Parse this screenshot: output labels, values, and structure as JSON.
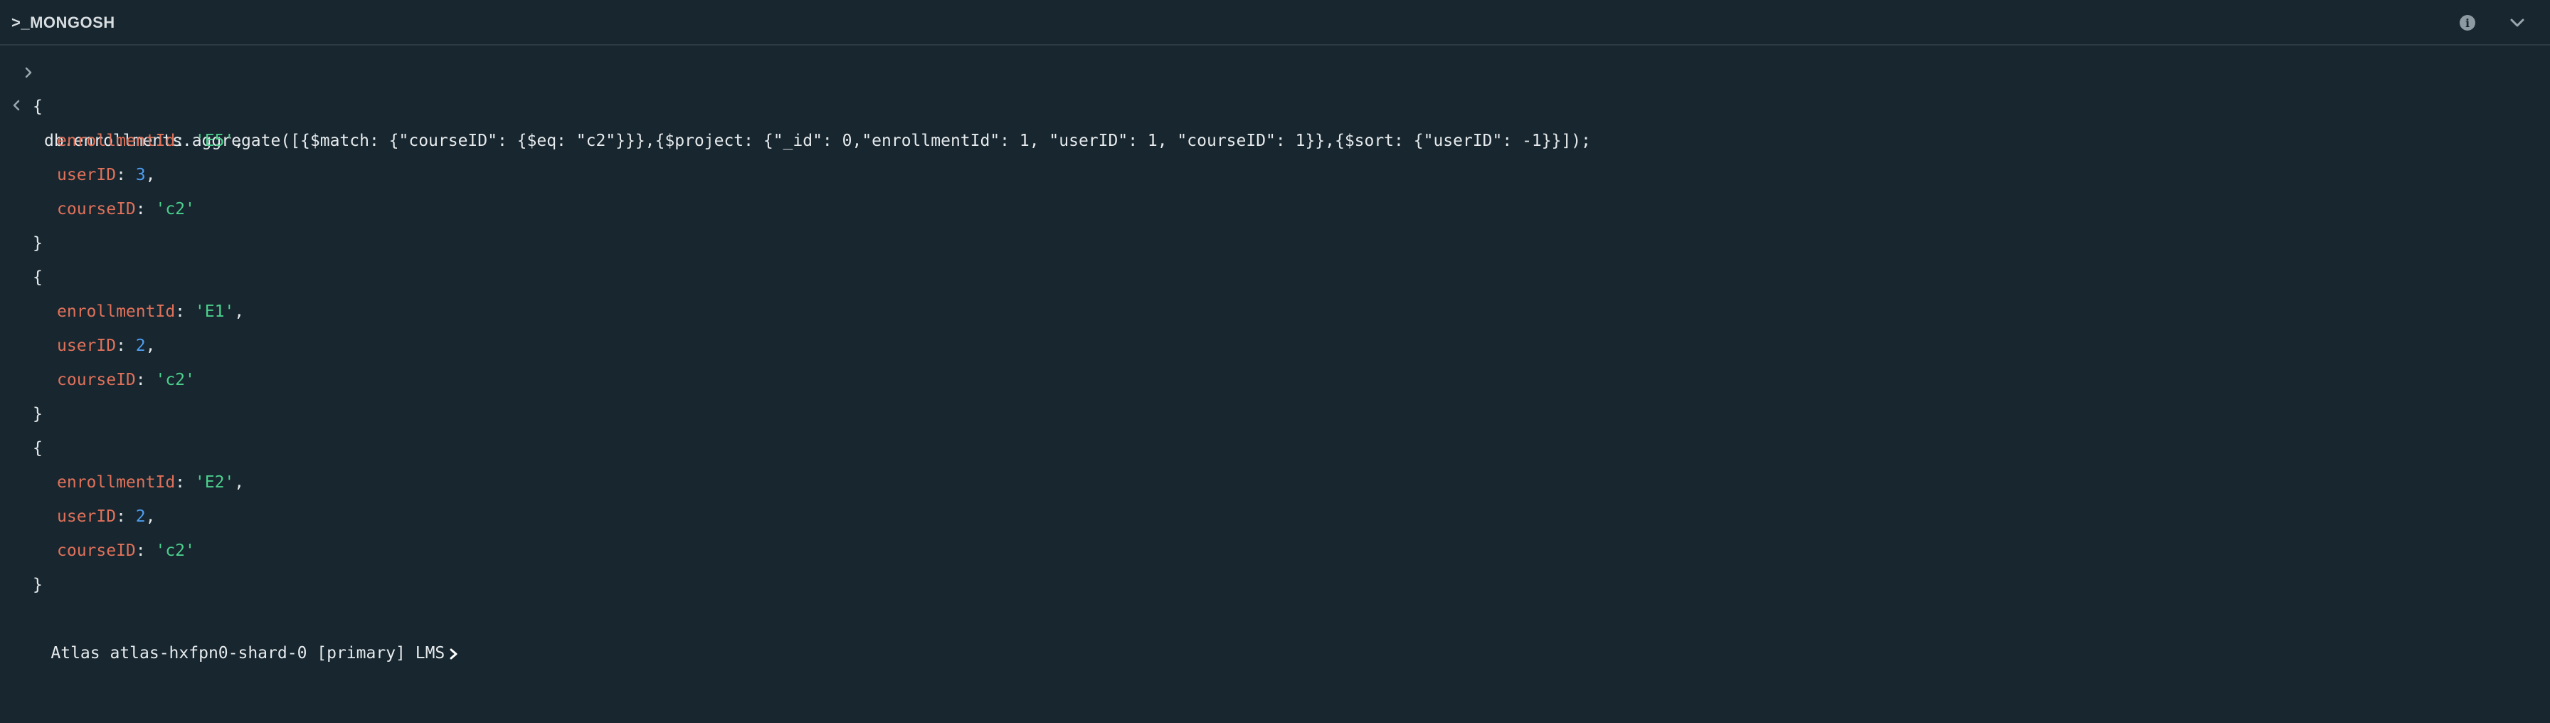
{
  "header": {
    "title": ">_MONGOSH",
    "info_icon": "info-icon",
    "collapse_icon": "chevron-down-icon"
  },
  "shell": {
    "input": "db.enrollments.aggregate([{$match: {\"courseID\": {$eq: \"c2\"}}},{$project: {\"_id\": 0,\"enrollmentId\": 1, \"userID\": 1, \"courseID\": 1}},{$sort: {\"userID\": -1}}]);",
    "results": [
      {
        "enrollmentId": "'E5'",
        "userID": "3",
        "courseID": "'c2'"
      },
      {
        "enrollmentId": "'E1'",
        "userID": "2",
        "courseID": "'c2'"
      },
      {
        "enrollmentId": "'E2'",
        "userID": "2",
        "courseID": "'c2'"
      }
    ],
    "keys": {
      "enrollmentId": "enrollmentId",
      "userID": "userID",
      "courseID": "courseID"
    },
    "prompt": "Atlas atlas-hxfpn0-shard-0 [primary] LMS"
  },
  "colors": {
    "background": "#17262f",
    "key": "#e0715a",
    "string": "#4cd08d",
    "number": "#4f9ef0"
  }
}
